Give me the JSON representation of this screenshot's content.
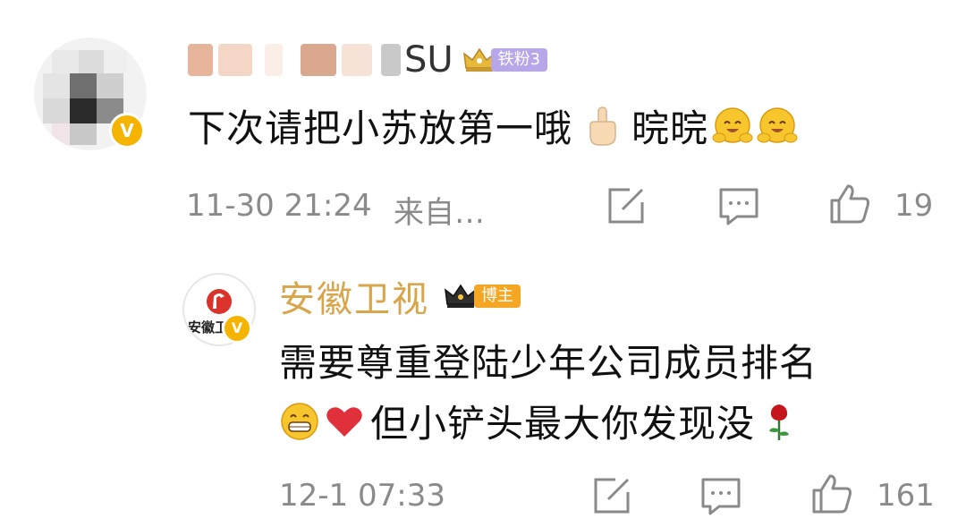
{
  "comment": {
    "user_suffix": "SU",
    "fan_badge": "铁粉3",
    "text": "下次请把小苏放第一哦",
    "text_after_emoji": "晥晥",
    "emojis": [
      "pointing-up-hand",
      "hugging-face",
      "hugging-face"
    ],
    "timestamp": "11-30 21:24",
    "source": "来自…",
    "like_count": "19"
  },
  "reply": {
    "avatar_text": "安徽卫",
    "user_name": "安徽卫视",
    "blogger_badge": "博主",
    "line1": "需要尊重登陆少年公司成员排名",
    "line2": "但小铲头最大你发现没",
    "emojis": [
      "grinning-face",
      "red-heart",
      "rose"
    ],
    "timestamp": "12-1 07:33",
    "like_count": "161"
  },
  "colors": {
    "verified_badge": "#f5b400",
    "fan_badge_bg": "#b7a7e8",
    "blogger_badge_bg": "#f5a623",
    "official_name": "#d8a54a",
    "meta_text": "#8a8a8a"
  }
}
